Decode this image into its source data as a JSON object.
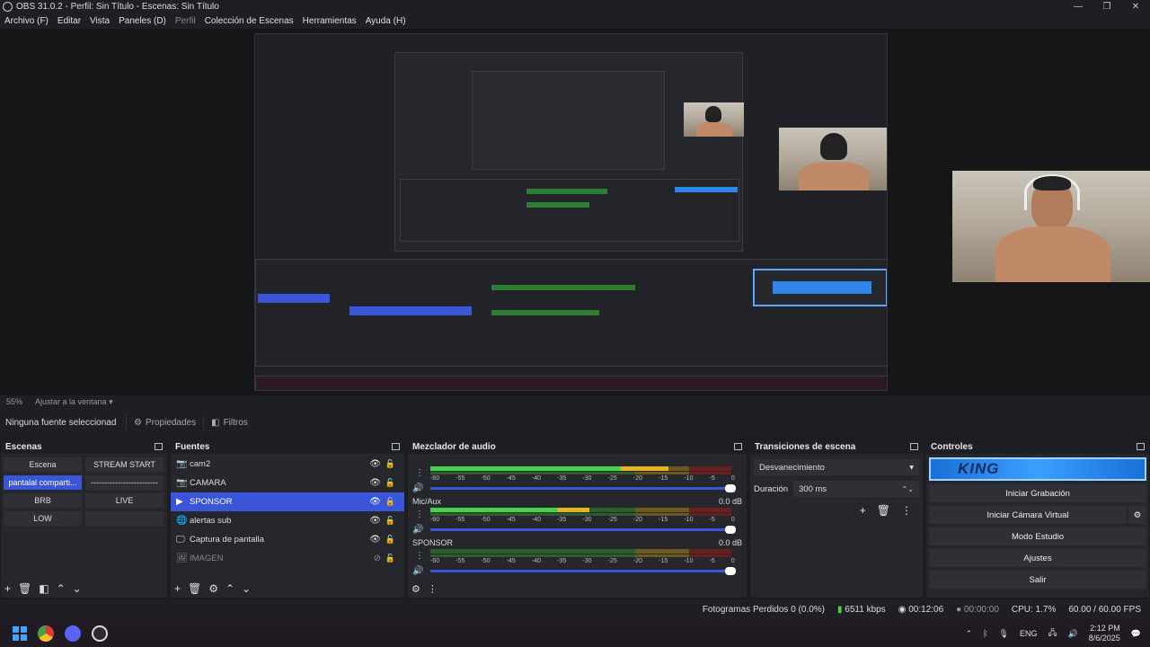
{
  "title_bar": {
    "title": "OBS 31.0.2 - Perfil: Sin Título - Escenas: Sin Título"
  },
  "menu": [
    "Archivo (F)",
    "Editar",
    "Vista",
    "Paneles (D)",
    "Perfil",
    "Colección de Escenas",
    "Herramientas",
    "Ayuda (H)"
  ],
  "preview_bar": {
    "zoom": "55%",
    "fit": "Ajustar a la ventana"
  },
  "toolbar": {
    "no_source": "Ninguna fuente seleccionad",
    "properties": "Propiedades",
    "filters": "Filtros"
  },
  "scenes": {
    "title": "Escenas",
    "items": [
      {
        "label": "Escena",
        "selected": false
      },
      {
        "label": "STREAM START",
        "selected": false
      },
      {
        "label": "pantalal comparti...",
        "selected": true
      },
      {
        "label": "-------------------------",
        "selected": false
      },
      {
        "label": "BRB",
        "selected": false
      },
      {
        "label": "LIVE",
        "selected": false
      },
      {
        "label": "LOW",
        "selected": false
      },
      {
        "label": "",
        "selected": false
      }
    ]
  },
  "sources": {
    "title": "Fuentes",
    "items": [
      {
        "label": "cam2",
        "icon": "camera-icon",
        "selected": false,
        "hidden": false
      },
      {
        "label": "CAMARA",
        "icon": "camera-icon",
        "selected": false,
        "hidden": false
      },
      {
        "label": "SPONSOR",
        "icon": "play-icon",
        "selected": true,
        "hidden": false
      },
      {
        "label": "alertas sub",
        "icon": "globe-icon",
        "selected": false,
        "hidden": false
      },
      {
        "label": "Captura de pantalla",
        "icon": "monitor-icon",
        "selected": false,
        "hidden": false
      },
      {
        "label": "IMAGEN",
        "icon": "image-icon",
        "selected": false,
        "hidden": true
      }
    ]
  },
  "mixer": {
    "title": "Mezclador de audio",
    "ticks": [
      "-60",
      "-55",
      "-50",
      "-45",
      "-40",
      "-35",
      "-30",
      "-25",
      "-20",
      "-15",
      "-10",
      "-5",
      "0"
    ],
    "channels": [
      {
        "name": "",
        "db": "",
        "level": 0.82
      },
      {
        "name": "Mic/Aux",
        "db": "0.0 dB",
        "level": 0.55
      },
      {
        "name": "SPONSOR",
        "db": "0.0 dB",
        "level": 0.0
      }
    ]
  },
  "transitions": {
    "title": "Transiciones de escena",
    "selected": "Desvanecimiento",
    "duration_label": "Duración",
    "duration_value": "300 ms"
  },
  "controls": {
    "title": "Controles",
    "banner": "KING",
    "buttons": [
      "Iniciar Grabación",
      "Iniciar Cámara Virtual",
      "Modo Estudio",
      "Ajustes",
      "Salir"
    ]
  },
  "status": {
    "dropped": "Fotogramas Perdidos 0 (0.0%)",
    "bitrate": "6511 kbps",
    "stream_time": "00:12:06",
    "rec_time": "00:00:00",
    "cpu": "CPU: 1.7%",
    "fps": "60.00 / 60.00 FPS"
  },
  "taskbar": {
    "lang": "ENG",
    "time": "2:12 PM",
    "date": "8/6/2025"
  }
}
